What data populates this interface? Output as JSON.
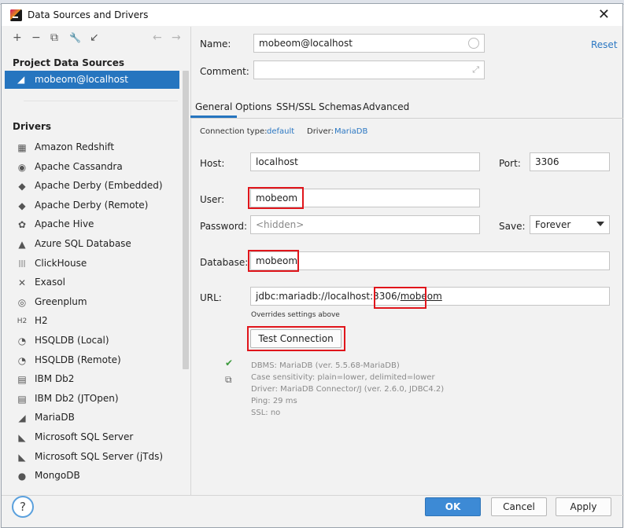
{
  "window": {
    "title": "Data Sources and Drivers",
    "close_glyph": "✕"
  },
  "toolbar": {
    "add": "+",
    "remove": "−",
    "copy": "⧉",
    "settings": "🔧",
    "import": "↙",
    "back": "←",
    "forward": "→"
  },
  "left": {
    "project_title": "Project Data Sources",
    "selected_source": "mobeom@localhost",
    "drivers_title": "Drivers",
    "drivers": [
      {
        "label": "Amazon Redshift",
        "icon": "redshift-icon",
        "glyph": "▦"
      },
      {
        "label": "Apache Cassandra",
        "icon": "cassandra-icon",
        "glyph": "◉"
      },
      {
        "label": "Apache Derby (Embedded)",
        "icon": "derby-icon",
        "glyph": "◆"
      },
      {
        "label": "Apache Derby (Remote)",
        "icon": "derby-icon",
        "glyph": "◆"
      },
      {
        "label": "Apache Hive",
        "icon": "hive-icon",
        "glyph": "✿"
      },
      {
        "label": "Azure SQL Database",
        "icon": "azure-icon",
        "glyph": "▲"
      },
      {
        "label": "ClickHouse",
        "icon": "clickhouse-icon",
        "glyph": "|||"
      },
      {
        "label": "Exasol",
        "icon": "exasol-icon",
        "glyph": "✕"
      },
      {
        "label": "Greenplum",
        "icon": "greenplum-icon",
        "glyph": "◎"
      },
      {
        "label": "H2",
        "icon": "h2-icon",
        "glyph": "H2"
      },
      {
        "label": "HSQLDB (Local)",
        "icon": "hsqldb-icon",
        "glyph": "◔"
      },
      {
        "label": "HSQLDB (Remote)",
        "icon": "hsqldb-icon",
        "glyph": "◔"
      },
      {
        "label": "IBM Db2",
        "icon": "ibm-icon",
        "glyph": "▤"
      },
      {
        "label": "IBM Db2 (JTOpen)",
        "icon": "ibm-icon",
        "glyph": "▤"
      },
      {
        "label": "MariaDB",
        "icon": "mariadb-icon",
        "glyph": "◢"
      },
      {
        "label": "Microsoft SQL Server",
        "icon": "mssql-icon",
        "glyph": "◣"
      },
      {
        "label": "Microsoft SQL Server (jTds)",
        "icon": "mssql-icon",
        "glyph": "◣"
      },
      {
        "label": "MongoDB",
        "icon": "mongodb-icon",
        "glyph": "●"
      }
    ],
    "help_glyph": "?"
  },
  "form": {
    "name_label": "Name:",
    "name_value": "mobeom@localhost",
    "reset_label": "Reset",
    "comment_label": "Comment:",
    "comment_value": "",
    "expand_glyph": "⤢",
    "tabs": [
      "General",
      "Options",
      "SSH/SSL",
      "Schemas",
      "Advanced"
    ],
    "conn_type_label": "Connection type:",
    "conn_type_value": "default",
    "driver_label": "Driver:",
    "driver_value": "MariaDB",
    "host_label": "Host:",
    "host_value": "localhost",
    "port_label": "Port:",
    "port_value": "3306",
    "user_label": "User:",
    "user_value": "mobeom",
    "password_label": "Password:",
    "password_placeholder": "<hidden>",
    "save_label": "Save:",
    "save_value": "Forever",
    "database_label": "Database:",
    "database_value": "mobeom",
    "url_label": "URL:",
    "url_prefix": "jdbc:mariadb://localhost:3306/",
    "url_suffix": "mobeom",
    "url_note": "Overrides settings above",
    "test_button": "Test Connection",
    "status_check": "✔",
    "copy_glyph": "⧉",
    "info_lines": [
      "DBMS: MariaDB (ver. 5.5.68-MariaDB)",
      "Case sensitivity: plain=lower, delimited=lower",
      "Driver: MariaDB Connector/J (ver. 2.6.0, JDBC4.2)",
      "Ping: 29 ms",
      "SSL: no"
    ]
  },
  "footer": {
    "ok": "OK",
    "cancel": "Cancel",
    "apply": "Apply"
  },
  "colors": {
    "accent": "#2675bf",
    "highlight": "#e0151b",
    "link": "#2b77c2",
    "success": "#3c9a3c"
  }
}
